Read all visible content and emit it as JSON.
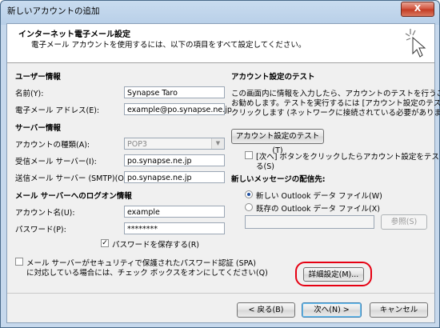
{
  "window": {
    "title": "新しいアカウントの追加",
    "close_label": "X"
  },
  "header": {
    "title": "インターネット電子メール設定",
    "subtitle": "電子メール アカウントを使用するには、以下の項目をすべて設定してください。",
    "icon": "cursor-sparkle-icon"
  },
  "user_info": {
    "heading": "ユーザー情報",
    "name_label": "名前(Y):",
    "name_value": "Synapse Taro",
    "email_label": "電子メール アドレス(E):",
    "email_value": "example@po.synapse.ne.jp"
  },
  "server_info": {
    "heading": "サーバー情報",
    "account_type_label": "アカウントの種類(A):",
    "account_type_value": "POP3",
    "incoming_label": "受信メール サーバー(I):",
    "incoming_value": "po.synapse.ne.jp",
    "outgoing_label": "送信メール サーバー (SMTP)(O):",
    "outgoing_value": "po.synapse.ne.jp"
  },
  "logon_info": {
    "heading": "メール サーバーへのログオン情報",
    "account_name_label": "アカウント名(U):",
    "account_name_value": "example",
    "password_label": "パスワード(P):",
    "password_value": "********",
    "save_password_label": "パスワードを保存する(R)",
    "save_password_checked": true,
    "spa_label_line1": "メール サーバーがセキュリティで保護されたパスワード認証 (SPA)",
    "spa_label_line2": "に対応している場合には、チェック ボックスをオンにしてください(Q)",
    "spa_checked": false
  },
  "account_test": {
    "heading": "アカウント設定のテスト",
    "description_line1": "この画面内に情報を入力したら、アカウントのテストを行うことを",
    "description_line2": "お勧めします。テストを実行するには [アカウント設定のテスト] を",
    "description_line3": "クリックします (ネットワークに接続されている必要があります)。",
    "test_button": "アカウント設定のテスト(T)",
    "auto_test_label_line1": "[次へ] ボタンをクリックしたらアカウント設定をテストす",
    "auto_test_label_line2": "る(S)",
    "auto_test_checked": false
  },
  "delivery": {
    "heading": "新しいメッセージの配信先:",
    "option_new": "新しい Outlook データ ファイル(W)",
    "option_existing": "既存の Outlook データ ファイル(X)",
    "selected": "new",
    "file_path": "",
    "browse_button": "参照(S)"
  },
  "more_settings_button": "詳細設定(M)...",
  "footer": {
    "back_button": "< 戻る(B)",
    "next_button": "次へ(N) >",
    "cancel_button": "キャンセル"
  },
  "colors": {
    "highlight": "#e60012",
    "title_bar": "#c9dcef",
    "dialog_bg": "#f0f0f0"
  }
}
